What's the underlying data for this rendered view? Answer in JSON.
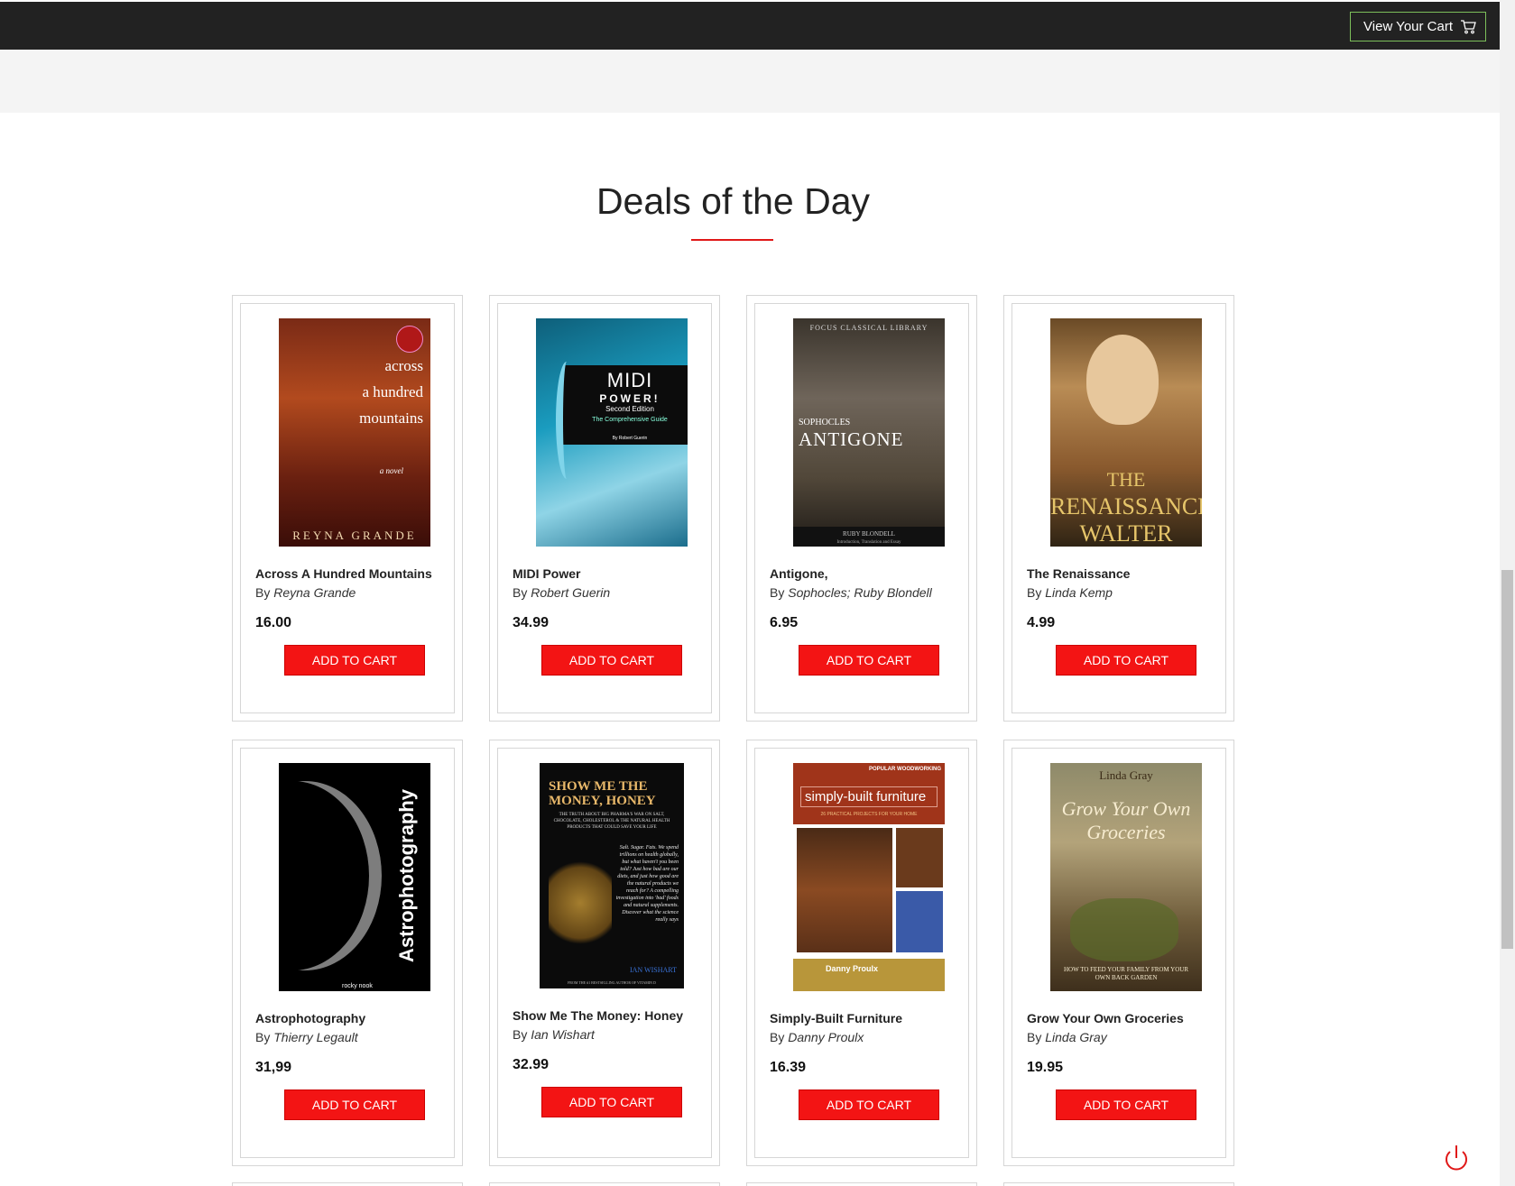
{
  "header": {
    "cart_label": "View Your Cart",
    "cart_icon": "shopping-cart-icon"
  },
  "section": {
    "title": "Deals of the Day",
    "accent_color": "#e01818"
  },
  "by_label": "By",
  "add_to_cart_label": "ADD TO CART",
  "books": [
    {
      "title": "Across A Hundred Mountains",
      "author": "Reyna Grande",
      "price": "16.00",
      "cover": {
        "line1": "across",
        "line2": "a hundred",
        "line3": "mountains",
        "author": "REYNA GRANDE",
        "subtitle": "a novel"
      }
    },
    {
      "title": "MIDI Power",
      "author": "Robert Guerin",
      "price": "34.99",
      "cover": {
        "line1": "MIDI",
        "line2": "POWER!",
        "line3": "Second Edition",
        "line4": "The Comprehensive Guide",
        "author": "By Robert Guerin"
      }
    },
    {
      "title": "Antigone,",
      "author": "Sophocles; Ruby Blondell",
      "price": "6.95",
      "cover": {
        "series": "FOCUS CLASSICAL LIBRARY",
        "line1": "SOPHOCLES",
        "line2": "ANTIGONE",
        "author": "RUBY BLONDELL",
        "note": "Introduction, Translation and Essay"
      }
    },
    {
      "title": "The Renaissance",
      "author": "Linda Kemp",
      "price": "4.99",
      "cover": {
        "line1": "THE",
        "line2": "RENAISSANCE",
        "line3": "WALTER PATER"
      }
    },
    {
      "title": "Astrophotography",
      "author": "Thierry Legault",
      "price": "31,99",
      "cover": {
        "line1": "Astrophotography",
        "publisher": "rocky nook"
      }
    },
    {
      "title": "Show Me The Money: Honey",
      "author": "Ian Wishart",
      "price": "32.99",
      "cover": {
        "line1": "SHOW ME THE",
        "line2": "MONEY, HONEY",
        "tagline": "THE TRUTH ABOUT BIG PHARMA'S WAR ON SALT, CHOCOLATE, CHOLESTEROL & THE NATURAL HEALTH PRODUCTS THAT COULD SAVE YOUR LIFE",
        "blurb": "Salt. Sugar. Fats. We spend trillions on health globally, but what haven't you been told? Just how bad are our diets, and just how good are the natural products we reach for? A compelling investigation into 'bad' foods and natural supplements. Discover what the science really says",
        "author": "IAN WISHART",
        "footer": "FROM THE #1 BESTSELLING AUTHOR OF VITAMIN D"
      }
    },
    {
      "title": "Simply-Built Furniture",
      "author": "Danny Proulx",
      "price": "16.39",
      "cover": {
        "brand": "POPULAR WOODWORKING",
        "line1": "simply-built furniture",
        "line2": "26 PRACTICAL PROJECTS FOR YOUR HOME",
        "author": "Danny Proulx"
      }
    },
    {
      "title": "Grow Your Own Groceries",
      "author": "Linda Gray",
      "price": "19.95",
      "cover": {
        "author": "Linda Gray",
        "line1": "Grow Your Own",
        "line2": "Groceries",
        "line3": "HOW TO FEED YOUR FAMILY FROM YOUR OWN BACK GARDEN"
      }
    }
  ]
}
